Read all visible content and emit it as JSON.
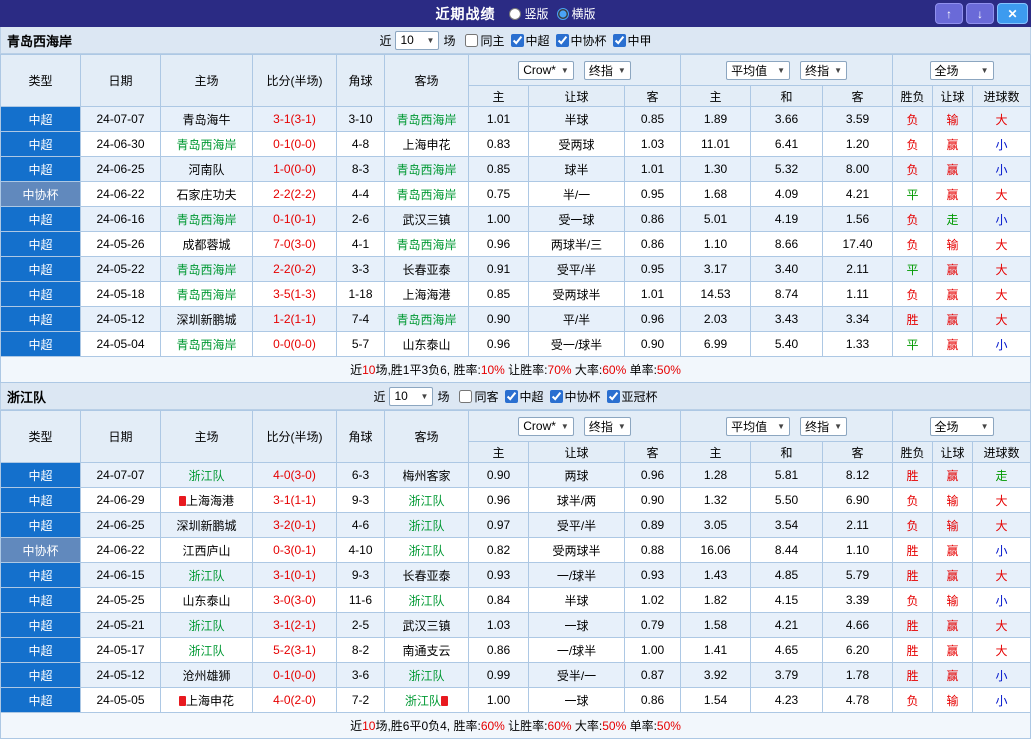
{
  "colors": {
    "titlebar_bg": "#2b2b84",
    "league_cell_blue": "#1470cc",
    "cup_cell_blue": "#6189bd",
    "tracked_team_green": "#009933",
    "score_red": "#e60000",
    "result_red": "#e60000",
    "result_green": "#009900",
    "result_blue": "#0014cc",
    "row_alt_bg": "#e7f0fa",
    "header_bg": "#e3edf7",
    "filter_bar_bg": "#dce7f3"
  },
  "icons": {
    "chevron_down": "▼",
    "up_arrow": "↑",
    "down_arrow": "↓",
    "close": "✕"
  },
  "titlebar": {
    "title": "近期战绩",
    "radio_vertical": "竖版",
    "radio_horizontal": "横版",
    "vertical_selected": false,
    "horizontal_selected": true
  },
  "labels": {
    "near": "近",
    "matches": "场"
  },
  "selects": {
    "provider": "Crow*",
    "final_index": "终指",
    "average": "平均值",
    "final_index2": "终指",
    "full_match": "全场"
  },
  "columns": {
    "type": "类型",
    "date": "日期",
    "home": "主场",
    "score": "比分(半场)",
    "corner": "角球",
    "away": "客场",
    "odds_home": "主",
    "odds_handicap": "让球",
    "odds_away": "客",
    "avg_home": "主",
    "avg_draw": "和",
    "avg_away": "客",
    "result": "胜负",
    "handicap_result": "让球",
    "goals": "进球数"
  },
  "sections": [
    {
      "team": "青岛西海岸",
      "filter": {
        "count": "10",
        "checkboxes": [
          {
            "label": "同主",
            "checked": false
          },
          {
            "label": "中超",
            "checked": true
          },
          {
            "label": "中协杯",
            "checked": true
          },
          {
            "label": "中甲",
            "checked": true
          }
        ]
      },
      "rows": [
        {
          "league": "中超",
          "league_class": "csl",
          "date": "24-07-07",
          "home": "青岛海牛",
          "home_class": "",
          "home_badge": false,
          "score": "3-1(3-1)",
          "corners": "3-10",
          "away": "青岛西海岸",
          "away_class": "tracked",
          "away_badge": false,
          "crown_home": "1.01",
          "handicap": "半球",
          "crown_away": "0.85",
          "avg_home": "1.89",
          "avg_draw": "3.66",
          "avg_away": "3.59",
          "result": "负",
          "result_class": "red",
          "asian": "输",
          "asian_class": "red",
          "ou": "大",
          "ou_class": "red"
        },
        {
          "league": "中超",
          "league_class": "csl",
          "date": "24-06-30",
          "home": "青岛西海岸",
          "home_class": "tracked",
          "home_badge": false,
          "score": "0-1(0-0)",
          "corners": "4-8",
          "away": "上海申花",
          "away_class": "",
          "away_badge": false,
          "crown_home": "0.83",
          "handicap": "受两球",
          "crown_away": "1.03",
          "avg_home": "11.01",
          "avg_draw": "6.41",
          "avg_away": "1.20",
          "result": "负",
          "result_class": "red",
          "asian": "赢",
          "asian_class": "red",
          "ou": "小",
          "ou_class": "blue"
        },
        {
          "league": "中超",
          "league_class": "csl",
          "date": "24-06-25",
          "home": "河南队",
          "home_class": "",
          "home_badge": false,
          "score": "1-0(0-0)",
          "corners": "8-3",
          "away": "青岛西海岸",
          "away_class": "tracked",
          "away_badge": false,
          "crown_home": "0.85",
          "handicap": "球半",
          "crown_away": "1.01",
          "avg_home": "1.30",
          "avg_draw": "5.32",
          "avg_away": "8.00",
          "result": "负",
          "result_class": "red",
          "asian": "赢",
          "asian_class": "red",
          "ou": "小",
          "ou_class": "blue"
        },
        {
          "league": "中协杯",
          "league_class": "cup",
          "date": "24-06-22",
          "home": "石家庄功夫",
          "home_class": "",
          "home_badge": false,
          "score": "2-2(2-2)",
          "corners": "4-4",
          "away": "青岛西海岸",
          "away_class": "tracked",
          "away_badge": false,
          "crown_home": "0.75",
          "handicap": "半/一",
          "crown_away": "0.95",
          "avg_home": "1.68",
          "avg_draw": "4.09",
          "avg_away": "4.21",
          "result": "平",
          "result_class": "green",
          "asian": "赢",
          "asian_class": "red",
          "ou": "大",
          "ou_class": "red"
        },
        {
          "league": "中超",
          "league_class": "csl",
          "date": "24-06-16",
          "home": "青岛西海岸",
          "home_class": "tracked",
          "home_badge": false,
          "score": "0-1(0-1)",
          "corners": "2-6",
          "away": "武汉三镇",
          "away_class": "",
          "away_badge": false,
          "crown_home": "1.00",
          "handicap": "受一球",
          "crown_away": "0.86",
          "avg_home": "5.01",
          "avg_draw": "4.19",
          "avg_away": "1.56",
          "result": "负",
          "result_class": "red",
          "asian": "走",
          "asian_class": "green",
          "ou": "小",
          "ou_class": "blue"
        },
        {
          "league": "中超",
          "league_class": "csl",
          "date": "24-05-26",
          "home": "成都蓉城",
          "home_class": "",
          "home_badge": false,
          "score": "7-0(3-0)",
          "corners": "4-1",
          "away": "青岛西海岸",
          "away_class": "tracked",
          "away_badge": false,
          "crown_home": "0.96",
          "handicap": "两球半/三",
          "crown_away": "0.86",
          "avg_home": "1.10",
          "avg_draw": "8.66",
          "avg_away": "17.40",
          "result": "负",
          "result_class": "red",
          "asian": "输",
          "asian_class": "red",
          "ou": "大",
          "ou_class": "red"
        },
        {
          "league": "中超",
          "league_class": "csl",
          "date": "24-05-22",
          "home": "青岛西海岸",
          "home_class": "tracked",
          "home_badge": false,
          "score": "2-2(0-2)",
          "corners": "3-3",
          "away": "长春亚泰",
          "away_class": "",
          "away_badge": false,
          "crown_home": "0.91",
          "handicap": "受平/半",
          "crown_away": "0.95",
          "avg_home": "3.17",
          "avg_draw": "3.40",
          "avg_away": "2.11",
          "result": "平",
          "result_class": "green",
          "asian": "赢",
          "asian_class": "red",
          "ou": "大",
          "ou_class": "red"
        },
        {
          "league": "中超",
          "league_class": "csl",
          "date": "24-05-18",
          "home": "青岛西海岸",
          "home_class": "tracked",
          "home_badge": false,
          "score": "3-5(1-3)",
          "corners": "1-18",
          "away": "上海海港",
          "away_class": "",
          "away_badge": false,
          "crown_home": "0.85",
          "handicap": "受两球半",
          "crown_away": "1.01",
          "avg_home": "14.53",
          "avg_draw": "8.74",
          "avg_away": "1.11",
          "result": "负",
          "result_class": "red",
          "asian": "赢",
          "asian_class": "red",
          "ou": "大",
          "ou_class": "red"
        },
        {
          "league": "中超",
          "league_class": "csl",
          "date": "24-05-12",
          "home": "深圳新鹏城",
          "home_class": "",
          "home_badge": false,
          "score": "1-2(1-1)",
          "corners": "7-4",
          "away": "青岛西海岸",
          "away_class": "tracked",
          "away_badge": false,
          "crown_home": "0.90",
          "handicap": "平/半",
          "crown_away": "0.96",
          "avg_home": "2.03",
          "avg_draw": "3.43",
          "avg_away": "3.34",
          "result": "胜",
          "result_class": "red",
          "asian": "赢",
          "asian_class": "red",
          "ou": "大",
          "ou_class": "red"
        },
        {
          "league": "中超",
          "league_class": "csl",
          "date": "24-05-04",
          "home": "青岛西海岸",
          "home_class": "tracked",
          "home_badge": false,
          "score": "0-0(0-0)",
          "corners": "5-7",
          "away": "山东泰山",
          "away_class": "",
          "away_badge": false,
          "crown_home": "0.96",
          "handicap": "受一/球半",
          "crown_away": "0.90",
          "avg_home": "6.99",
          "avg_draw": "5.40",
          "avg_away": "1.33",
          "result": "平",
          "result_class": "green",
          "asian": "赢",
          "asian_class": "red",
          "ou": "小",
          "ou_class": "blue"
        }
      ],
      "summary": [
        {
          "t": "近",
          "c": ""
        },
        {
          "t": "10",
          "c": "red"
        },
        {
          "t": "场,胜1平3负6, 胜率:",
          "c": ""
        },
        {
          "t": "10%",
          "c": "red"
        },
        {
          "t": " 让胜率:",
          "c": ""
        },
        {
          "t": "70%",
          "c": "red"
        },
        {
          "t": " 大率:",
          "c": ""
        },
        {
          "t": "60%",
          "c": "red"
        },
        {
          "t": " 单率:",
          "c": ""
        },
        {
          "t": "50%",
          "c": "red"
        }
      ]
    },
    {
      "team": "浙江队",
      "filter": {
        "count": "10",
        "checkboxes": [
          {
            "label": "同客",
            "checked": false
          },
          {
            "label": "中超",
            "checked": true
          },
          {
            "label": "中协杯",
            "checked": true
          },
          {
            "label": "亚冠杯",
            "checked": true
          }
        ]
      },
      "rows": [
        {
          "league": "中超",
          "league_class": "csl",
          "date": "24-07-07",
          "home": "浙江队",
          "home_class": "tracked",
          "home_badge": false,
          "score": "4-0(3-0)",
          "corners": "6-3",
          "away": "梅州客家",
          "away_class": "",
          "away_badge": false,
          "crown_home": "0.90",
          "handicap": "两球",
          "crown_away": "0.96",
          "avg_home": "1.28",
          "avg_draw": "5.81",
          "avg_away": "8.12",
          "result": "胜",
          "result_class": "red",
          "asian": "赢",
          "asian_class": "red",
          "ou": "走",
          "ou_class": "green"
        },
        {
          "league": "中超",
          "league_class": "csl",
          "date": "24-06-29",
          "home": "上海海港",
          "home_class": "",
          "home_badge": true,
          "score": "3-1(1-1)",
          "corners": "9-3",
          "away": "浙江队",
          "away_class": "tracked",
          "away_badge": false,
          "crown_home": "0.96",
          "handicap": "球半/两",
          "crown_away": "0.90",
          "avg_home": "1.32",
          "avg_draw": "5.50",
          "avg_away": "6.90",
          "result": "负",
          "result_class": "red",
          "asian": "输",
          "asian_class": "red",
          "ou": "大",
          "ou_class": "red"
        },
        {
          "league": "中超",
          "league_class": "csl",
          "date": "24-06-25",
          "home": "深圳新鹏城",
          "home_class": "",
          "home_badge": false,
          "score": "3-2(0-1)",
          "corners": "4-6",
          "away": "浙江队",
          "away_class": "tracked",
          "away_badge": false,
          "crown_home": "0.97",
          "handicap": "受平/半",
          "crown_away": "0.89",
          "avg_home": "3.05",
          "avg_draw": "3.54",
          "avg_away": "2.11",
          "result": "负",
          "result_class": "red",
          "asian": "输",
          "asian_class": "red",
          "ou": "大",
          "ou_class": "red"
        },
        {
          "league": "中协杯",
          "league_class": "cup",
          "date": "24-06-22",
          "home": "江西庐山",
          "home_class": "",
          "home_badge": false,
          "score": "0-3(0-1)",
          "corners": "4-10",
          "away": "浙江队",
          "away_class": "tracked",
          "away_badge": false,
          "crown_home": "0.82",
          "handicap": "受两球半",
          "crown_away": "0.88",
          "avg_home": "16.06",
          "avg_draw": "8.44",
          "avg_away": "1.10",
          "result": "胜",
          "result_class": "red",
          "asian": "赢",
          "asian_class": "red",
          "ou": "小",
          "ou_class": "blue"
        },
        {
          "league": "中超",
          "league_class": "csl",
          "date": "24-06-15",
          "home": "浙江队",
          "home_class": "tracked",
          "home_badge": false,
          "score": "3-1(0-1)",
          "corners": "9-3",
          "away": "长春亚泰",
          "away_class": "",
          "away_badge": false,
          "crown_home": "0.93",
          "handicap": "一/球半",
          "crown_away": "0.93",
          "avg_home": "1.43",
          "avg_draw": "4.85",
          "avg_away": "5.79",
          "result": "胜",
          "result_class": "red",
          "asian": "赢",
          "asian_class": "red",
          "ou": "大",
          "ou_class": "red"
        },
        {
          "league": "中超",
          "league_class": "csl",
          "date": "24-05-25",
          "home": "山东泰山",
          "home_class": "",
          "home_badge": false,
          "score": "3-0(3-0)",
          "corners": "11-6",
          "away": "浙江队",
          "away_class": "tracked",
          "away_badge": false,
          "crown_home": "0.84",
          "handicap": "半球",
          "crown_away": "1.02",
          "avg_home": "1.82",
          "avg_draw": "4.15",
          "avg_away": "3.39",
          "result": "负",
          "result_class": "red",
          "asian": "输",
          "asian_class": "red",
          "ou": "小",
          "ou_class": "blue"
        },
        {
          "league": "中超",
          "league_class": "csl",
          "date": "24-05-21",
          "home": "浙江队",
          "home_class": "tracked",
          "home_badge": false,
          "score": "3-1(2-1)",
          "corners": "2-5",
          "away": "武汉三镇",
          "away_class": "",
          "away_badge": false,
          "crown_home": "1.03",
          "handicap": "一球",
          "crown_away": "0.79",
          "avg_home": "1.58",
          "avg_draw": "4.21",
          "avg_away": "4.66",
          "result": "胜",
          "result_class": "red",
          "asian": "赢",
          "asian_class": "red",
          "ou": "大",
          "ou_class": "red"
        },
        {
          "league": "中超",
          "league_class": "csl",
          "date": "24-05-17",
          "home": "浙江队",
          "home_class": "tracked",
          "home_badge": false,
          "score": "5-2(3-1)",
          "corners": "8-2",
          "away": "南通支云",
          "away_class": "",
          "away_badge": false,
          "crown_home": "0.86",
          "handicap": "一/球半",
          "crown_away": "1.00",
          "avg_home": "1.41",
          "avg_draw": "4.65",
          "avg_away": "6.20",
          "result": "胜",
          "result_class": "red",
          "asian": "赢",
          "asian_class": "red",
          "ou": "大",
          "ou_class": "red"
        },
        {
          "league": "中超",
          "league_class": "csl",
          "date": "24-05-12",
          "home": "沧州雄狮",
          "home_class": "",
          "home_badge": false,
          "score": "0-1(0-0)",
          "corners": "3-6",
          "away": "浙江队",
          "away_class": "tracked",
          "away_badge": false,
          "crown_home": "0.99",
          "handicap": "受半/一",
          "crown_away": "0.87",
          "avg_home": "3.92",
          "avg_draw": "3.79",
          "avg_away": "1.78",
          "result": "胜",
          "result_class": "red",
          "asian": "赢",
          "asian_class": "red",
          "ou": "小",
          "ou_class": "blue"
        },
        {
          "league": "中超",
          "league_class": "csl",
          "date": "24-05-05",
          "home": "上海申花",
          "home_class": "",
          "home_badge": true,
          "score": "4-0(2-0)",
          "corners": "7-2",
          "away": "浙江队",
          "away_class": "tracked",
          "away_badge": true,
          "crown_home": "1.00",
          "handicap": "一球",
          "crown_away": "0.86",
          "avg_home": "1.54",
          "avg_draw": "4.23",
          "avg_away": "4.78",
          "result": "负",
          "result_class": "red",
          "asian": "输",
          "asian_class": "red",
          "ou": "小",
          "ou_class": "blue"
        }
      ],
      "summary": [
        {
          "t": "近",
          "c": ""
        },
        {
          "t": "10",
          "c": "red"
        },
        {
          "t": "场,胜6平0负4, 胜率:",
          "c": ""
        },
        {
          "t": "60%",
          "c": "red"
        },
        {
          "t": " 让胜率:",
          "c": ""
        },
        {
          "t": "60%",
          "c": "red"
        },
        {
          "t": " 大率:",
          "c": ""
        },
        {
          "t": "50%",
          "c": "red"
        },
        {
          "t": " 单率:",
          "c": ""
        },
        {
          "t": "50%",
          "c": "red"
        }
      ]
    }
  ]
}
